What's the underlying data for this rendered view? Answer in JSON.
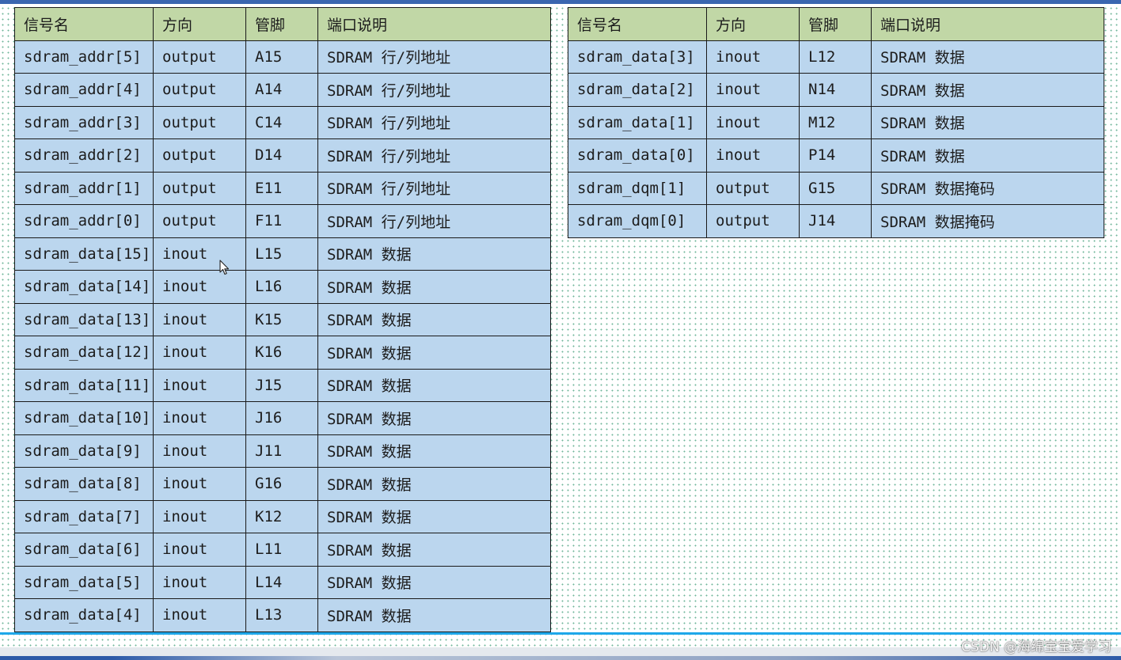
{
  "headers": {
    "signal": "信号名",
    "direction": "方向",
    "pin": "管脚",
    "description": "端口说明"
  },
  "left_table": {
    "rows": [
      {
        "signal": "sdram_addr[5]",
        "direction": "output",
        "pin": "A15",
        "description": "SDRAM 行/列地址"
      },
      {
        "signal": "sdram_addr[4]",
        "direction": "output",
        "pin": "A14",
        "description": "SDRAM 行/列地址"
      },
      {
        "signal": "sdram_addr[3]",
        "direction": "output",
        "pin": "C14",
        "description": "SDRAM 行/列地址"
      },
      {
        "signal": "sdram_addr[2]",
        "direction": "output",
        "pin": "D14",
        "description": "SDRAM 行/列地址"
      },
      {
        "signal": "sdram_addr[1]",
        "direction": "output",
        "pin": "E11",
        "description": "SDRAM 行/列地址"
      },
      {
        "signal": "sdram_addr[0]",
        "direction": "output",
        "pin": "F11",
        "description": "SDRAM 行/列地址"
      },
      {
        "signal": "sdram_data[15]",
        "direction": "inout",
        "pin": "L15",
        "description": "SDRAM 数据"
      },
      {
        "signal": "sdram_data[14]",
        "direction": "inout",
        "pin": "L16",
        "description": "SDRAM 数据"
      },
      {
        "signal": "sdram_data[13]",
        "direction": "inout",
        "pin": "K15",
        "description": "SDRAM 数据"
      },
      {
        "signal": "sdram_data[12]",
        "direction": "inout",
        "pin": "K16",
        "description": "SDRAM 数据"
      },
      {
        "signal": "sdram_data[11]",
        "direction": "inout",
        "pin": "J15",
        "description": "SDRAM 数据"
      },
      {
        "signal": "sdram_data[10]",
        "direction": "inout",
        "pin": "J16",
        "description": "SDRAM 数据"
      },
      {
        "signal": "sdram_data[9]",
        "direction": "inout",
        "pin": "J11",
        "description": "SDRAM 数据"
      },
      {
        "signal": "sdram_data[8]",
        "direction": "inout",
        "pin": "G16",
        "description": "SDRAM 数据"
      },
      {
        "signal": "sdram_data[7]",
        "direction": "inout",
        "pin": "K12",
        "description": "SDRAM 数据"
      },
      {
        "signal": "sdram_data[6]",
        "direction": "inout",
        "pin": "L11",
        "description": "SDRAM 数据"
      },
      {
        "signal": "sdram_data[5]",
        "direction": "inout",
        "pin": "L14",
        "description": "SDRAM 数据"
      },
      {
        "signal": "sdram_data[4]",
        "direction": "inout",
        "pin": "L13",
        "description": "SDRAM 数据"
      }
    ]
  },
  "right_table": {
    "rows": [
      {
        "signal": "sdram_data[3]",
        "direction": "inout",
        "pin": "L12",
        "description": "SDRAM 数据"
      },
      {
        "signal": "sdram_data[2]",
        "direction": "inout",
        "pin": "N14",
        "description": "SDRAM 数据"
      },
      {
        "signal": "sdram_data[1]",
        "direction": "inout",
        "pin": "M12",
        "description": "SDRAM 数据"
      },
      {
        "signal": "sdram_data[0]",
        "direction": "inout",
        "pin": "P14",
        "description": "SDRAM 数据"
      },
      {
        "signal": "sdram_dqm[1]",
        "direction": "output",
        "pin": "G15",
        "description": "SDRAM 数据掩码"
      },
      {
        "signal": "sdram_dqm[0]",
        "direction": "output",
        "pin": "J14",
        "description": "SDRAM 数据掩码"
      }
    ]
  },
  "watermark": "CSDN @海绵宝宝爱学习",
  "colors": {
    "header_bg": "#c1d7a6",
    "cell_bg": "#bbd6ee",
    "border": "#1a1a1a",
    "accent_line": "#1ea7ea"
  },
  "icons": {
    "cursor": "mouse-pointer-icon"
  }
}
